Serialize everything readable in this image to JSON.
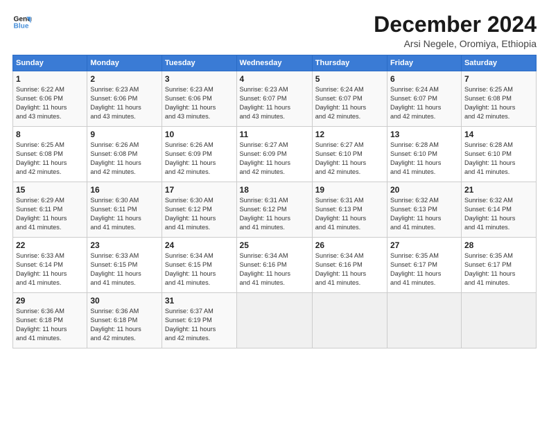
{
  "logo": {
    "line1": "General",
    "line2": "Blue"
  },
  "title": "December 2024",
  "subtitle": "Arsi Negele, Oromiya, Ethiopia",
  "header_days": [
    "Sunday",
    "Monday",
    "Tuesday",
    "Wednesday",
    "Thursday",
    "Friday",
    "Saturday"
  ],
  "weeks": [
    [
      {
        "day": "1",
        "info": "Sunrise: 6:22 AM\nSunset: 6:06 PM\nDaylight: 11 hours\nand 43 minutes."
      },
      {
        "day": "2",
        "info": "Sunrise: 6:23 AM\nSunset: 6:06 PM\nDaylight: 11 hours\nand 43 minutes."
      },
      {
        "day": "3",
        "info": "Sunrise: 6:23 AM\nSunset: 6:06 PM\nDaylight: 11 hours\nand 43 minutes."
      },
      {
        "day": "4",
        "info": "Sunrise: 6:23 AM\nSunset: 6:07 PM\nDaylight: 11 hours\nand 43 minutes."
      },
      {
        "day": "5",
        "info": "Sunrise: 6:24 AM\nSunset: 6:07 PM\nDaylight: 11 hours\nand 42 minutes."
      },
      {
        "day": "6",
        "info": "Sunrise: 6:24 AM\nSunset: 6:07 PM\nDaylight: 11 hours\nand 42 minutes."
      },
      {
        "day": "7",
        "info": "Sunrise: 6:25 AM\nSunset: 6:08 PM\nDaylight: 11 hours\nand 42 minutes."
      }
    ],
    [
      {
        "day": "8",
        "info": "Sunrise: 6:25 AM\nSunset: 6:08 PM\nDaylight: 11 hours\nand 42 minutes."
      },
      {
        "day": "9",
        "info": "Sunrise: 6:26 AM\nSunset: 6:08 PM\nDaylight: 11 hours\nand 42 minutes."
      },
      {
        "day": "10",
        "info": "Sunrise: 6:26 AM\nSunset: 6:09 PM\nDaylight: 11 hours\nand 42 minutes."
      },
      {
        "day": "11",
        "info": "Sunrise: 6:27 AM\nSunset: 6:09 PM\nDaylight: 11 hours\nand 42 minutes."
      },
      {
        "day": "12",
        "info": "Sunrise: 6:27 AM\nSunset: 6:10 PM\nDaylight: 11 hours\nand 42 minutes."
      },
      {
        "day": "13",
        "info": "Sunrise: 6:28 AM\nSunset: 6:10 PM\nDaylight: 11 hours\nand 41 minutes."
      },
      {
        "day": "14",
        "info": "Sunrise: 6:28 AM\nSunset: 6:10 PM\nDaylight: 11 hours\nand 41 minutes."
      }
    ],
    [
      {
        "day": "15",
        "info": "Sunrise: 6:29 AM\nSunset: 6:11 PM\nDaylight: 11 hours\nand 41 minutes."
      },
      {
        "day": "16",
        "info": "Sunrise: 6:30 AM\nSunset: 6:11 PM\nDaylight: 11 hours\nand 41 minutes."
      },
      {
        "day": "17",
        "info": "Sunrise: 6:30 AM\nSunset: 6:12 PM\nDaylight: 11 hours\nand 41 minutes."
      },
      {
        "day": "18",
        "info": "Sunrise: 6:31 AM\nSunset: 6:12 PM\nDaylight: 11 hours\nand 41 minutes."
      },
      {
        "day": "19",
        "info": "Sunrise: 6:31 AM\nSunset: 6:13 PM\nDaylight: 11 hours\nand 41 minutes."
      },
      {
        "day": "20",
        "info": "Sunrise: 6:32 AM\nSunset: 6:13 PM\nDaylight: 11 hours\nand 41 minutes."
      },
      {
        "day": "21",
        "info": "Sunrise: 6:32 AM\nSunset: 6:14 PM\nDaylight: 11 hours\nand 41 minutes."
      }
    ],
    [
      {
        "day": "22",
        "info": "Sunrise: 6:33 AM\nSunset: 6:14 PM\nDaylight: 11 hours\nand 41 minutes."
      },
      {
        "day": "23",
        "info": "Sunrise: 6:33 AM\nSunset: 6:15 PM\nDaylight: 11 hours\nand 41 minutes."
      },
      {
        "day": "24",
        "info": "Sunrise: 6:34 AM\nSunset: 6:15 PM\nDaylight: 11 hours\nand 41 minutes."
      },
      {
        "day": "25",
        "info": "Sunrise: 6:34 AM\nSunset: 6:16 PM\nDaylight: 11 hours\nand 41 minutes."
      },
      {
        "day": "26",
        "info": "Sunrise: 6:34 AM\nSunset: 6:16 PM\nDaylight: 11 hours\nand 41 minutes."
      },
      {
        "day": "27",
        "info": "Sunrise: 6:35 AM\nSunset: 6:17 PM\nDaylight: 11 hours\nand 41 minutes."
      },
      {
        "day": "28",
        "info": "Sunrise: 6:35 AM\nSunset: 6:17 PM\nDaylight: 11 hours\nand 41 minutes."
      }
    ],
    [
      {
        "day": "29",
        "info": "Sunrise: 6:36 AM\nSunset: 6:18 PM\nDaylight: 11 hours\nand 41 minutes."
      },
      {
        "day": "30",
        "info": "Sunrise: 6:36 AM\nSunset: 6:18 PM\nDaylight: 11 hours\nand 42 minutes."
      },
      {
        "day": "31",
        "info": "Sunrise: 6:37 AM\nSunset: 6:19 PM\nDaylight: 11 hours\nand 42 minutes."
      },
      null,
      null,
      null,
      null
    ]
  ]
}
